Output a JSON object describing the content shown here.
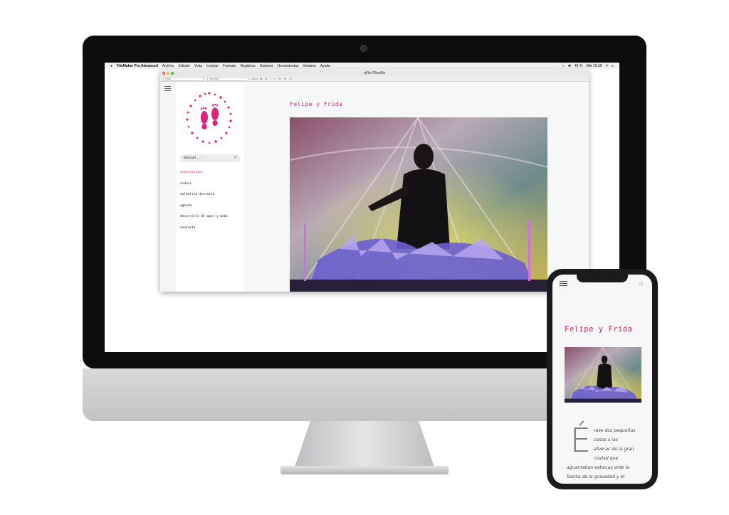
{
  "menubar": {
    "apple": "",
    "app_name": "FileMaker Pro Advanced",
    "menus": [
      "Archivo",
      "Edición",
      "Vista",
      "Insertar",
      "Formato",
      "Registros",
      "Guiones",
      "Herramientas",
      "Ventana",
      "Ayuda"
    ],
    "battery": "45 %",
    "clock": "Mié 19:39"
  },
  "window": {
    "title": "aFile Plantilla",
    "toolbar_font": "Arial",
    "toolbar_style": "Normal",
    "toolbar_size": "18 pt"
  },
  "sidebar": {
    "search_placeholder": "buscar...",
    "items": [
      {
        "label": "espectáculos",
        "active": true
      },
      {
        "label": "videos",
        "active": false
      },
      {
        "label": "carmelita descalza",
        "active": false
      },
      {
        "label": "agenda",
        "active": false
      },
      {
        "label": "desarrollo de apps y webs",
        "active": false
      },
      {
        "label": "contacto",
        "active": false
      }
    ]
  },
  "main": {
    "title": "Felipe y Frida"
  },
  "phone": {
    "title": "Felipe y Frida",
    "drop_cap": "É",
    "lines": [
      "rase dos pequeñas",
      "casas a las",
      "afueras de la gran",
      "ciudad que",
      "aguantaban estoicas ante la",
      "fuerza de la gravedad y el"
    ]
  },
  "colors": {
    "accent": "#e0237a",
    "bezel": "#0d0d0d"
  }
}
